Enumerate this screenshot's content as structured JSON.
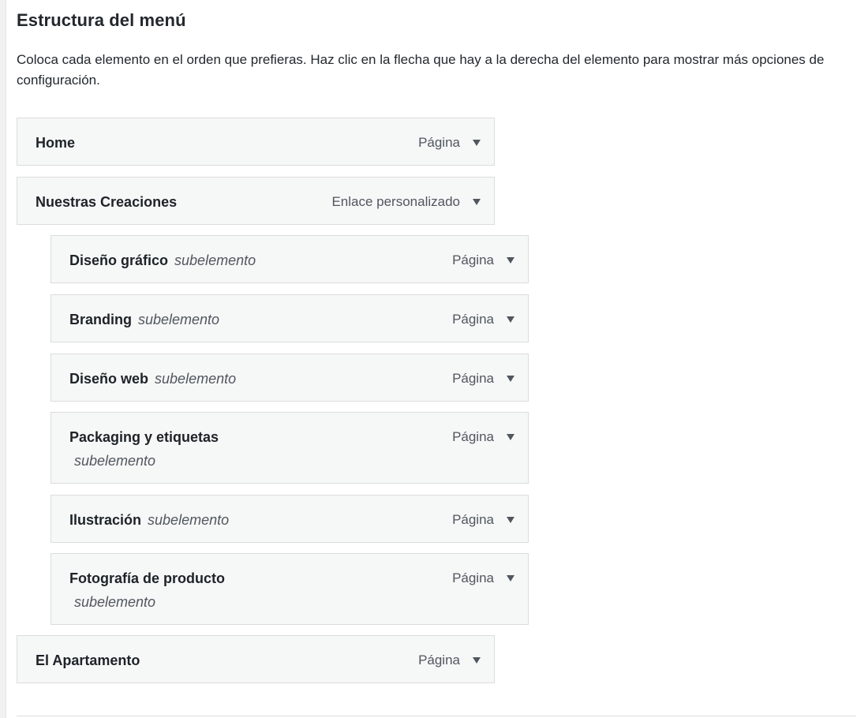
{
  "section": {
    "title": "Estructura del menú",
    "description": "Coloca cada elemento en el orden que prefieras. Haz clic en la flecha que hay a la derecha del elemento para mostrar más opciones de configuración."
  },
  "menu_items": [
    {
      "name": "Home",
      "type": "Página",
      "sub": ""
    },
    {
      "name": "Nuestras Creaciones",
      "type": "Enlace personalizado",
      "sub": ""
    },
    {
      "name": "Diseño gráfico",
      "type": "Página",
      "sub": "subelemento"
    },
    {
      "name": "Branding",
      "type": "Página",
      "sub": "subelemento"
    },
    {
      "name": "Diseño web",
      "type": "Página",
      "sub": "subelemento"
    },
    {
      "name": "Packaging y etiquetas",
      "type": "Página",
      "sub": "subelemento"
    },
    {
      "name": "Ilustración",
      "type": "Página",
      "sub": "subelemento"
    },
    {
      "name": "Fotografía de producto",
      "type": "Página",
      "sub": "subelemento"
    },
    {
      "name": "El Apartamento",
      "type": "Página",
      "sub": ""
    }
  ],
  "icons": {
    "toggle": "chevron-down-icon"
  }
}
